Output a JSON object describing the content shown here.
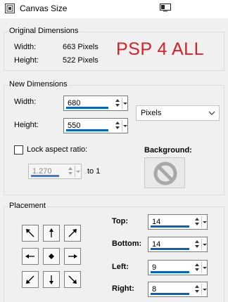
{
  "window": {
    "title": "Canvas Size",
    "app_icon": "psp-icon",
    "titlebar_icon": "monitor-icon"
  },
  "original": {
    "group_label": "Original Dimensions",
    "width_label": "Width:",
    "width_value": "663 Pixels",
    "height_label": "Height:",
    "height_value": "522 Pixels"
  },
  "watermark": {
    "text": "PSP 4 ALL",
    "color": "#e11d24"
  },
  "new": {
    "group_label": "New Dimensions",
    "width_label": "Width:",
    "width_value": "680",
    "height_label": "Height:",
    "height_value": "550",
    "units_selected": "Pixels",
    "lock_label": "Lock aspect ratio:",
    "lock_checked": false,
    "ratio_value": "1.270",
    "ratio_suffix": "to 1",
    "background_label": "Background:",
    "background_icon": "no-color-icon"
  },
  "placement": {
    "group_label": "Placement",
    "anchors": [
      "top-left",
      "top",
      "top-right",
      "left",
      "center",
      "right",
      "bottom-left",
      "bottom",
      "bottom-right"
    ],
    "top_label": "Top:",
    "top_value": "14",
    "bottom_label": "Bottom:",
    "bottom_value": "14",
    "left_label": "Left:",
    "left_value": "9",
    "right_label": "Right:",
    "right_value": "8"
  },
  "colors": {
    "accent": "#0067c0",
    "window_bg": "#f0f0f0"
  }
}
